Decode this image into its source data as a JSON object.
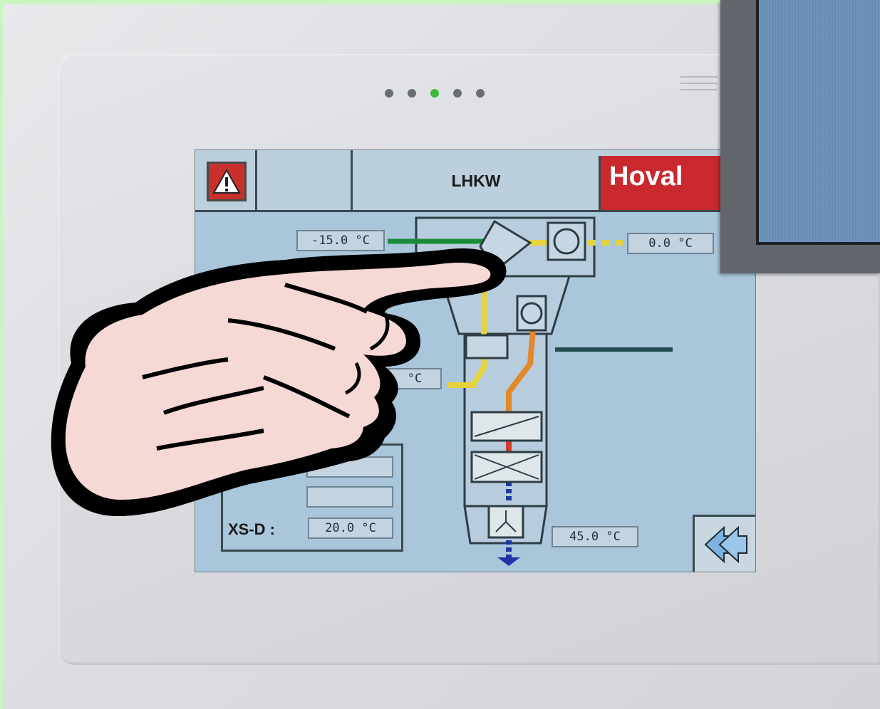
{
  "header": {
    "title": "LHKW",
    "brand": "Hoval"
  },
  "readouts": {
    "outside_air": "-15.0 °C",
    "supply_air": "0.0 °C",
    "mid_left": "°C",
    "xs_d_value": "20.0 °C",
    "water_temp": "45.0 °C"
  },
  "side_panel": {
    "label": "XS-D  :"
  },
  "icons": {
    "alarm": "warning-triangle-icon",
    "back": "double-left-arrow-icon"
  },
  "colors": {
    "brand_red": "#c8282e",
    "screen_bg": "#a9c6da",
    "active_dot": "#3dbb3a"
  }
}
